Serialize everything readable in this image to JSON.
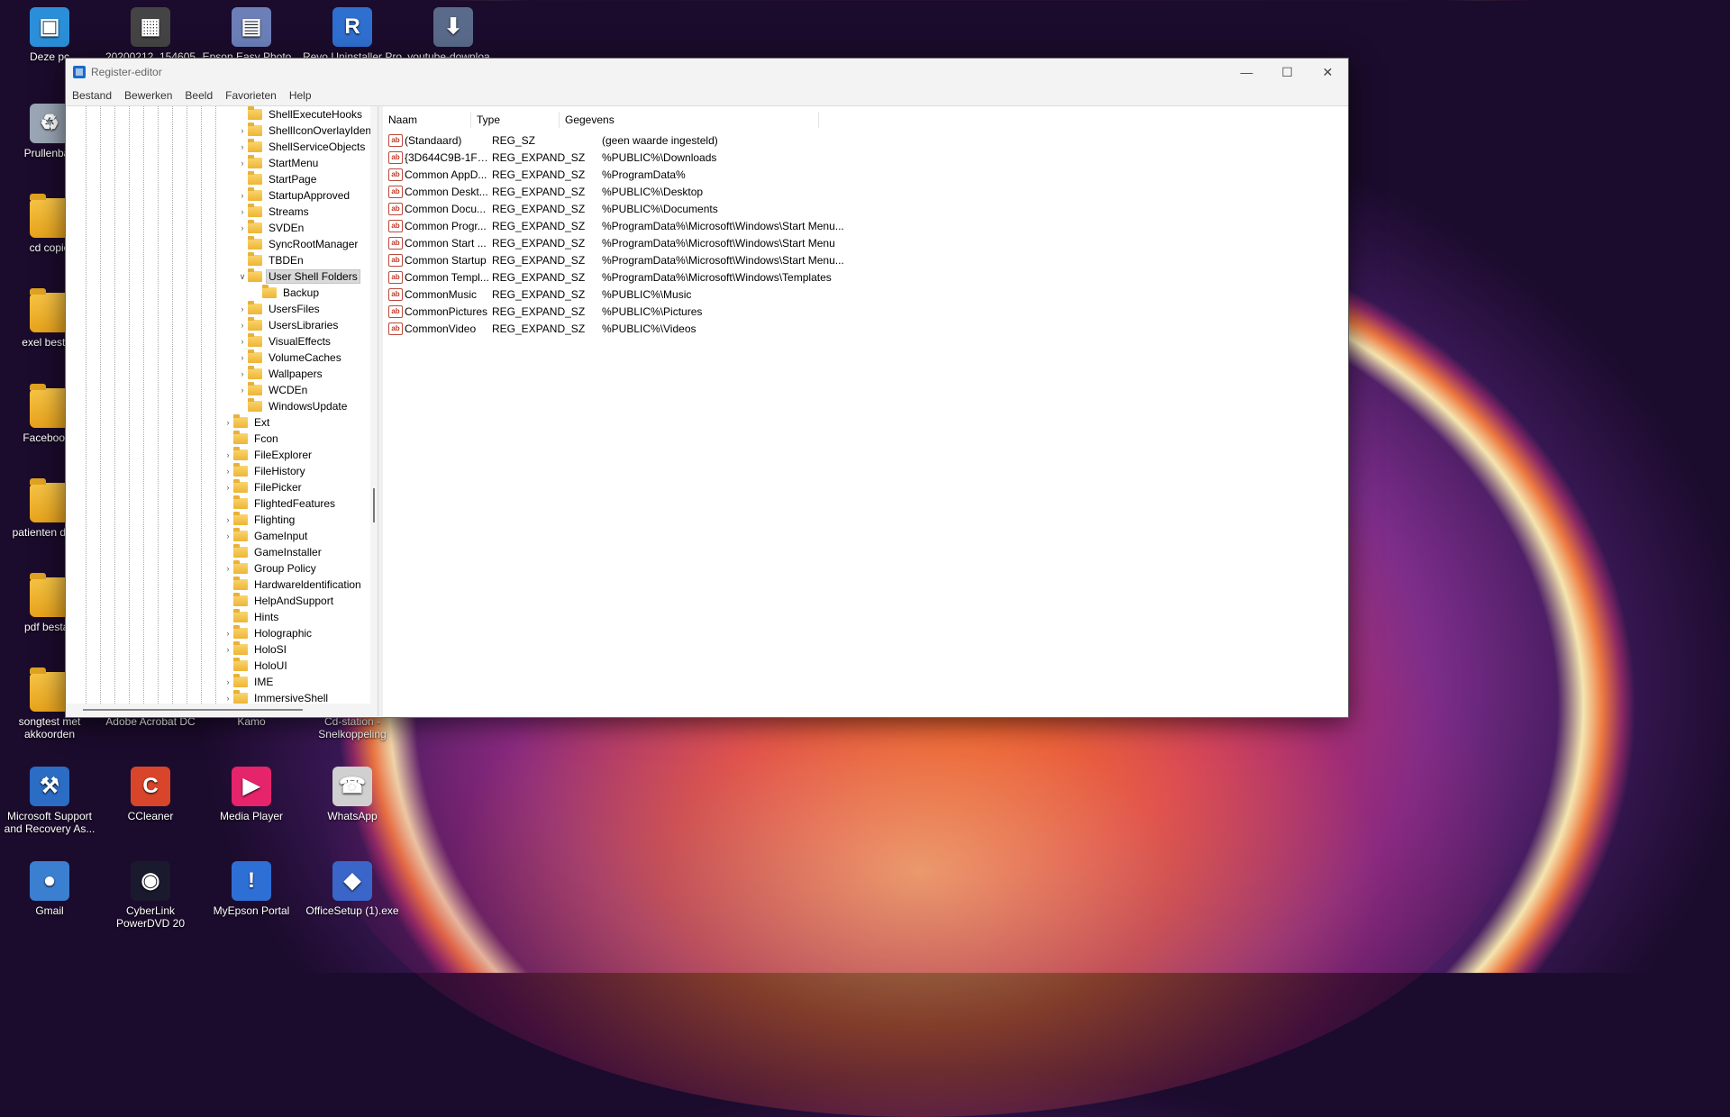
{
  "desktop": {
    "icons": [
      {
        "label": "Deze pc",
        "icon": "monitor-icon",
        "color": "#2a8fd8"
      },
      {
        "label": "20200212_154605",
        "icon": "photo-icon",
        "color": "#444444"
      },
      {
        "label": "Epson Easy Photo...",
        "icon": "photo-app-icon",
        "color": "#6c7fb8"
      },
      {
        "label": "Revo Uninstaller Pro",
        "icon": "revo-icon",
        "color": "#2f6fd0"
      },
      {
        "label": "youtube-downloa...",
        "icon": "installer-icon",
        "color": "#5a6a8a"
      },
      {
        "label": "Prullenbak",
        "icon": "recycle-bin-icon",
        "color": "#9aa6b5"
      },
      {
        "label": "cd copie",
        "icon": "folder-icon",
        "color": "#f2b233"
      },
      {
        "label": "exel bestan",
        "icon": "folder-icon",
        "color": "#f2b233"
      },
      {
        "label": "Facebook_",
        "icon": "folder-icon",
        "color": "#f2b233"
      },
      {
        "label": "patienten d bob",
        "icon": "folder-icon",
        "color": "#f2b233"
      },
      {
        "label": "pdf bestan",
        "icon": "folder-icon",
        "color": "#f2b233"
      },
      {
        "label": "songtest met akkoorden",
        "icon": "folder-icon",
        "color": "#f2b233"
      },
      {
        "label": "Adobe Acrobat DC",
        "icon": "acrobat-icon",
        "color": "#d23b2e"
      },
      {
        "label": "Kamo",
        "icon": "kamo-icon",
        "color": "#3b6fd8"
      },
      {
        "label": "Cd-station - Snelkoppeling",
        "icon": "cd-drive-icon",
        "color": "#8a8a8a"
      },
      {
        "label": "Microsoft Support and Recovery As...",
        "icon": "tools-icon",
        "color": "#2b6cc4"
      },
      {
        "label": "CCleaner",
        "icon": "ccleaner-icon",
        "color": "#d9452b"
      },
      {
        "label": "Media Player",
        "icon": "media-player-icon",
        "color": "#e5246b"
      },
      {
        "label": "WhatsApp",
        "icon": "whatsapp-icon",
        "color": "#d0d0d0"
      },
      {
        "label": "Gmail",
        "icon": "globe-icon",
        "color": "#3b7fd1"
      },
      {
        "label": "CyberLink PowerDVD 20",
        "icon": "powerdvd-icon",
        "color": "#1a1a2e"
      },
      {
        "label": "MyEpson Portal",
        "icon": "epson-portal-icon",
        "color": "#2e6fd6"
      },
      {
        "label": "OfficeSetup (1).exe",
        "icon": "office-icon",
        "color": "#3a66c9"
      }
    ]
  },
  "window": {
    "title": "Register-editor",
    "menu": [
      "Bestand",
      "Bewerken",
      "Beeld",
      "Favorieten",
      "Help"
    ],
    "tree": [
      {
        "label": "ShellExecuteHooks",
        "expandable": false,
        "selected": false
      },
      {
        "label": "ShellIconOverlayIdentifiers",
        "expandable": true,
        "selected": false
      },
      {
        "label": "ShellServiceObjects",
        "expandable": true,
        "selected": false
      },
      {
        "label": "StartMenu",
        "expandable": true,
        "selected": false
      },
      {
        "label": "StartPage",
        "expandable": false,
        "selected": false
      },
      {
        "label": "StartupApproved",
        "expandable": true,
        "selected": false
      },
      {
        "label": "Streams",
        "expandable": true,
        "selected": false
      },
      {
        "label": "SVDEn",
        "expandable": true,
        "selected": false
      },
      {
        "label": "SyncRootManager",
        "expandable": false,
        "selected": false
      },
      {
        "label": "TBDEn",
        "expandable": false,
        "selected": false
      },
      {
        "label": "User Shell Folders",
        "expandable": true,
        "expanded": true,
        "selected": true
      },
      {
        "label": "Backup",
        "expandable": false,
        "selected": false,
        "child": true
      },
      {
        "label": "UsersFiles",
        "expandable": true,
        "selected": false
      },
      {
        "label": "UsersLibraries",
        "expandable": true,
        "selected": false
      },
      {
        "label": "VisualEffects",
        "expandable": true,
        "selected": false
      },
      {
        "label": "VolumeCaches",
        "expandable": true,
        "selected": false
      },
      {
        "label": "Wallpapers",
        "expandable": true,
        "selected": false
      },
      {
        "label": "WCDEn",
        "expandable": true,
        "selected": false
      },
      {
        "label": "WindowsUpdate",
        "expandable": false,
        "selected": false
      },
      {
        "label": "Ext",
        "expandable": true,
        "selected": false,
        "parent": true
      },
      {
        "label": "Fcon",
        "expandable": false,
        "selected": false,
        "parent": true
      },
      {
        "label": "FileExplorer",
        "expandable": true,
        "selected": false,
        "parent": true
      },
      {
        "label": "FileHistory",
        "expandable": true,
        "selected": false,
        "parent": true
      },
      {
        "label": "FilePicker",
        "expandable": true,
        "selected": false,
        "parent": true
      },
      {
        "label": "FlightedFeatures",
        "expandable": false,
        "selected": false,
        "parent": true
      },
      {
        "label": "Flighting",
        "expandable": true,
        "selected": false,
        "parent": true
      },
      {
        "label": "GameInput",
        "expandable": true,
        "selected": false,
        "parent": true
      },
      {
        "label": "GameInstaller",
        "expandable": false,
        "selected": false,
        "parent": true
      },
      {
        "label": "Group Policy",
        "expandable": true,
        "selected": false,
        "parent": true
      },
      {
        "label": "Hardwareldentification",
        "expandable": false,
        "selected": false,
        "parent": true
      },
      {
        "label": "HelpAndSupport",
        "expandable": false,
        "selected": false,
        "parent": true
      },
      {
        "label": "Hints",
        "expandable": false,
        "selected": false,
        "parent": true
      },
      {
        "label": "Holographic",
        "expandable": true,
        "selected": false,
        "parent": true
      },
      {
        "label": "HoloSI",
        "expandable": true,
        "selected": false,
        "parent": true
      },
      {
        "label": "HoloUI",
        "expandable": false,
        "selected": false,
        "parent": true
      },
      {
        "label": "IME",
        "expandable": true,
        "selected": false,
        "parent": true
      },
      {
        "label": "ImmersiveShell",
        "expandable": true,
        "selected": false,
        "parent": true
      }
    ],
    "columns": [
      "Naam",
      "Type",
      "Gegevens"
    ],
    "values": [
      {
        "name": "(Standaard)",
        "type": "REG_SZ",
        "data": "(geen waarde ingesteld)"
      },
      {
        "name": "{3D644C9B-1FB8...",
        "type": "REG_EXPAND_SZ",
        "data": "%PUBLIC%\\Downloads"
      },
      {
        "name": "Common AppD...",
        "type": "REG_EXPAND_SZ",
        "data": "%ProgramData%"
      },
      {
        "name": "Common Deskt...",
        "type": "REG_EXPAND_SZ",
        "data": "%PUBLIC%\\Desktop"
      },
      {
        "name": "Common Docu...",
        "type": "REG_EXPAND_SZ",
        "data": "%PUBLIC%\\Documents"
      },
      {
        "name": "Common Progr...",
        "type": "REG_EXPAND_SZ",
        "data": "%ProgramData%\\Microsoft\\Windows\\Start Menu..."
      },
      {
        "name": "Common Start ...",
        "type": "REG_EXPAND_SZ",
        "data": "%ProgramData%\\Microsoft\\Windows\\Start Menu"
      },
      {
        "name": "Common Startup",
        "type": "REG_EXPAND_SZ",
        "data": "%ProgramData%\\Microsoft\\Windows\\Start Menu..."
      },
      {
        "name": "Common Templ...",
        "type": "REG_EXPAND_SZ",
        "data": "%ProgramData%\\Microsoft\\Windows\\Templates"
      },
      {
        "name": "CommonMusic",
        "type": "REG_EXPAND_SZ",
        "data": "%PUBLIC%\\Music"
      },
      {
        "name": "CommonPictures",
        "type": "REG_EXPAND_SZ",
        "data": "%PUBLIC%\\Pictures"
      },
      {
        "name": "CommonVideo",
        "type": "REG_EXPAND_SZ",
        "data": "%PUBLIC%\\Videos"
      }
    ]
  }
}
